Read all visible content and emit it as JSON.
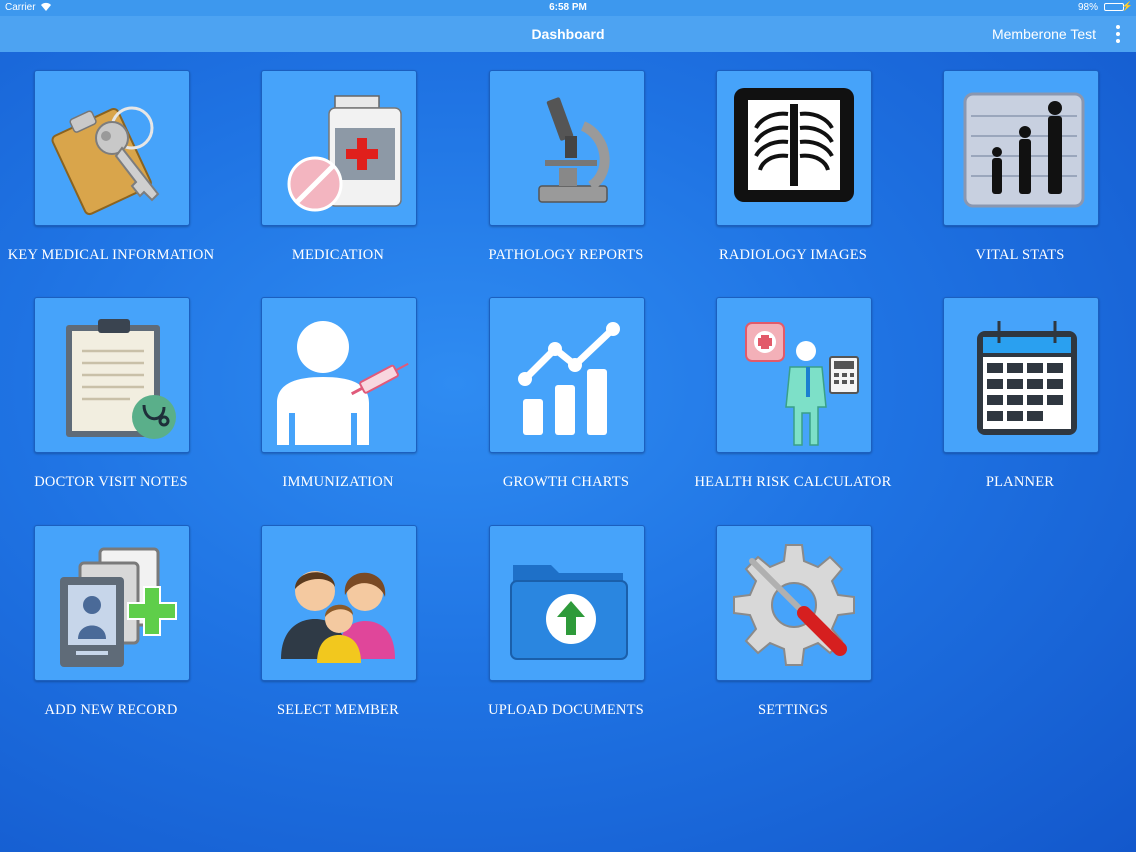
{
  "status_bar": {
    "carrier": "Carrier",
    "time": "6:58 PM",
    "battery": "98%"
  },
  "nav": {
    "title": "Dashboard",
    "user": "Memberone Test"
  },
  "tiles": [
    {
      "label": "KEY MEDICAL INFORMATION",
      "icon": "key-card-icon"
    },
    {
      "label": "MEDICATION",
      "icon": "medicine-bottle-icon"
    },
    {
      "label": "PATHOLOGY REPORTS",
      "icon": "microscope-icon"
    },
    {
      "label": "RADIOLOGY IMAGES",
      "icon": "xray-icon"
    },
    {
      "label": "VITAL STATS",
      "icon": "height-chart-icon"
    },
    {
      "label": "DOCTOR VISIT NOTES",
      "icon": "clipboard-stethoscope-icon"
    },
    {
      "label": "IMMUNIZATION",
      "icon": "person-syringe-icon"
    },
    {
      "label": "GROWTH CHARTS",
      "icon": "growth-chart-icon"
    },
    {
      "label": "HEALTH RISK CALCULATOR",
      "icon": "doctor-calculator-icon"
    },
    {
      "label": "PLANNER",
      "icon": "calendar-icon"
    },
    {
      "label": "ADD NEW RECORD",
      "icon": "add-record-icon"
    },
    {
      "label": "SELECT MEMBER",
      "icon": "family-icon"
    },
    {
      "label": "UPLOAD DOCUMENTS",
      "icon": "upload-folder-icon"
    },
    {
      "label": "SETTINGS",
      "icon": "gear-screwdriver-icon"
    }
  ],
  "colors": {
    "tile_bg": "#46a3fa",
    "nav_bg": "#4da3f2",
    "page_bg": "#1f73e3"
  }
}
